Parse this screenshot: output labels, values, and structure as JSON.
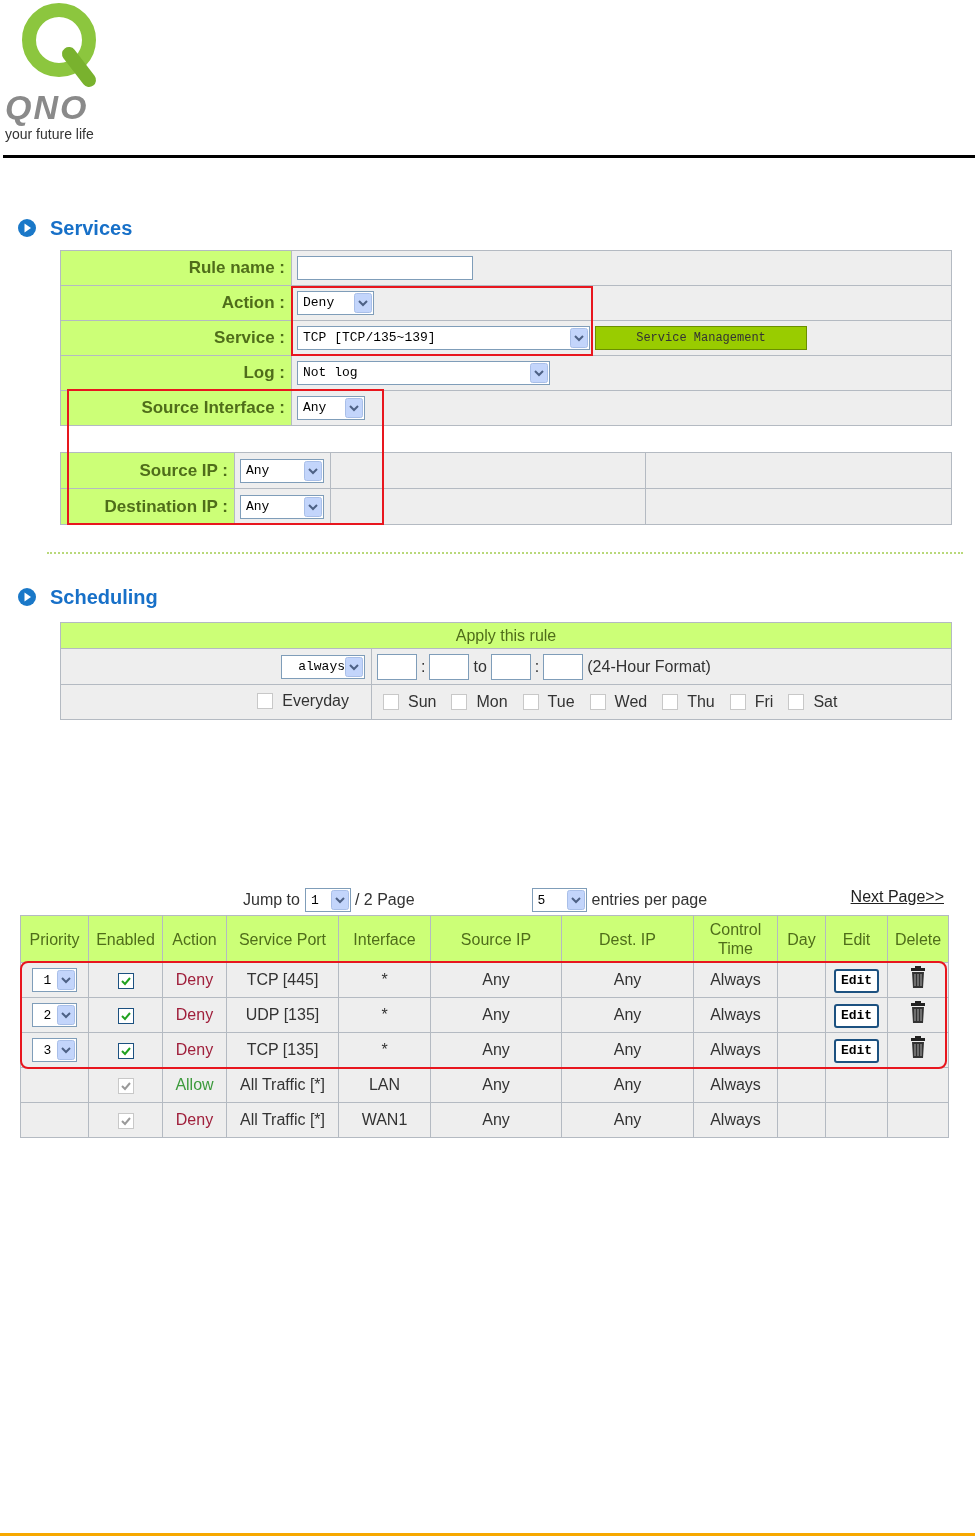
{
  "logo": {
    "brand": "QNO",
    "tagline": "your future life"
  },
  "services": {
    "title": "Services",
    "fields": [
      {
        "kind": "text",
        "label": "Rule name :"
      },
      {
        "kind": "select",
        "label": "Action :",
        "value": "Deny"
      },
      {
        "kind": "select",
        "label": "Service :",
        "value": "TCP [TCP/135~139]",
        "button": "Service Management"
      },
      {
        "kind": "select",
        "label": "Log :",
        "value": "Not log"
      },
      {
        "kind": "select",
        "label": "Source Interface :",
        "value": "Any"
      }
    ],
    "address_fields": [
      {
        "label": "Source IP :",
        "value": "Any"
      },
      {
        "label": "Destination IP :",
        "value": "Any"
      }
    ]
  },
  "scheduling": {
    "title": "Scheduling",
    "header": "Apply this rule",
    "mode": "always",
    "separators": [
      ":",
      ":"
    ],
    "to": "to",
    "format": "(24-Hour Format)",
    "everyday": {
      "label": "Everyday",
      "checked": false
    },
    "days": [
      {
        "label": "Sun",
        "checked": false
      },
      {
        "label": "Mon",
        "checked": false
      },
      {
        "label": "Tue",
        "checked": false
      },
      {
        "label": "Wed",
        "checked": false
      },
      {
        "label": "Thu",
        "checked": false
      },
      {
        "label": "Fri",
        "checked": false
      },
      {
        "label": "Sat",
        "checked": false
      }
    ]
  },
  "rules": {
    "jump_label": "Jump to",
    "page": "1",
    "page_total": "/ 2 Page",
    "per_page": "5",
    "per_page_label": "entries per page",
    "next": "Next Page>>",
    "columns": [
      "Priority",
      "Enabled",
      "Action",
      "Service Port",
      "Interface",
      "Source IP",
      "Dest. IP",
      "Control Time",
      "Day",
      "Edit",
      "Delete"
    ],
    "rows": [
      {
        "priority": "1",
        "enabled": {
          "checked": true,
          "disabled": false
        },
        "action": "Deny",
        "color": "#a0203c",
        "service_port": "TCP [445]",
        "interface": "*",
        "source_ip": "Any",
        "dest_ip": "Any",
        "control_time": "Always",
        "edit": "Edit",
        "deletable": true
      },
      {
        "priority": "2",
        "enabled": {
          "checked": true,
          "disabled": false
        },
        "action": "Deny",
        "color": "#a0203c",
        "service_port": "UDP [135]",
        "interface": "*",
        "source_ip": "Any",
        "dest_ip": "Any",
        "control_time": "Always",
        "edit": "Edit",
        "deletable": true
      },
      {
        "priority": "3",
        "enabled": {
          "checked": true,
          "disabled": false
        },
        "action": "Deny",
        "color": "#a0203c",
        "service_port": "TCP [135]",
        "interface": "*",
        "source_ip": "Any",
        "dest_ip": "Any",
        "control_time": "Always",
        "edit": "Edit",
        "deletable": true
      },
      {
        "enabled": {
          "checked": true,
          "disabled": true
        },
        "action": "Allow",
        "color": "#3c9a3c",
        "service_port": "All Traffic [*]",
        "interface": "LAN",
        "source_ip": "Any",
        "dest_ip": "Any",
        "control_time": "Always",
        "deletable": false
      },
      {
        "enabled": {
          "checked": true,
          "disabled": true
        },
        "action": "Deny",
        "color": "#a0203c",
        "service_port": "All Traffic [*]",
        "interface": "WAN1",
        "source_ip": "Any",
        "dest_ip": "Any",
        "control_time": "Always",
        "deletable": false
      }
    ]
  }
}
